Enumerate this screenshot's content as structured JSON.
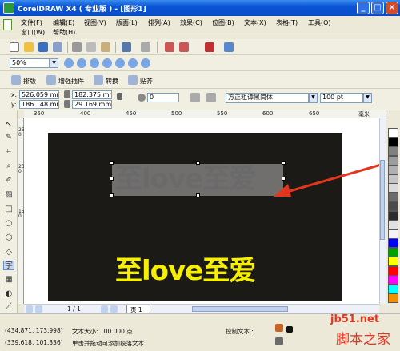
{
  "window": {
    "title": "CorelDRAW X4 ( 专业版 ) - [图形1]",
    "minimize": "_",
    "maximize": "□",
    "close": "×"
  },
  "menu": {
    "row1": [
      "文件(F)",
      "编辑(E)",
      "视图(V)",
      "版面(L)",
      "排列(A)",
      "效果(C)",
      "位图(B)",
      "文本(X)",
      "表格(T)",
      "工具(O)"
    ],
    "row2": [
      "窗口(W)",
      "帮助(H)"
    ]
  },
  "zoom": {
    "value": "50%"
  },
  "toolbar3": {
    "items": [
      "排版",
      "增强插件",
      "转换",
      "贴齐"
    ]
  },
  "property_bar": {
    "x": "526.059 mm",
    "y": "186.148 mm",
    "w": "182.375 mm",
    "h": "29.169 mm",
    "rotation": "0",
    "font_name": "方正粗谭黑简体",
    "font_size": "100 pt"
  },
  "ruler": {
    "top": [
      "350",
      "400",
      "450",
      "500",
      "550",
      "600",
      "650"
    ],
    "unit": "毫米",
    "left": [
      "250",
      "200",
      "150"
    ]
  },
  "canvas": {
    "text_selected": "至love至爱",
    "text_yellow": "至love至爱"
  },
  "page_nav": {
    "counter": "1 / 1",
    "tab": "页 1"
  },
  "status": {
    "coords1": "(434.871, 173.998)",
    "info1": "文本大小: 100.000 点",
    "coords2": "(339.618, 101.336)",
    "info2": "单击并拖动可添加段落文本",
    "control_text": "控制文本 :"
  },
  "watermark": {
    "line1": "jb51.net",
    "line2": "脚本之家"
  },
  "colors": {
    "titlebar": "#0a55d6",
    "page_bg": "#1c1a16",
    "text_yellow": "#f6f000",
    "palette": [
      "#ffffff",
      "#000000",
      "#808080",
      "#9c9c9c",
      "#b0b0b0",
      "#c4c4c4",
      "#dadada",
      "#6b6b6b",
      "#4a4a4a",
      "#2b2b2b",
      "#e0e0e0",
      "#f4f4f4",
      "#0000ff",
      "#00a000",
      "#ffff00",
      "#ff0000",
      "#ff00ff",
      "#00ffff",
      "#f09000"
    ]
  }
}
